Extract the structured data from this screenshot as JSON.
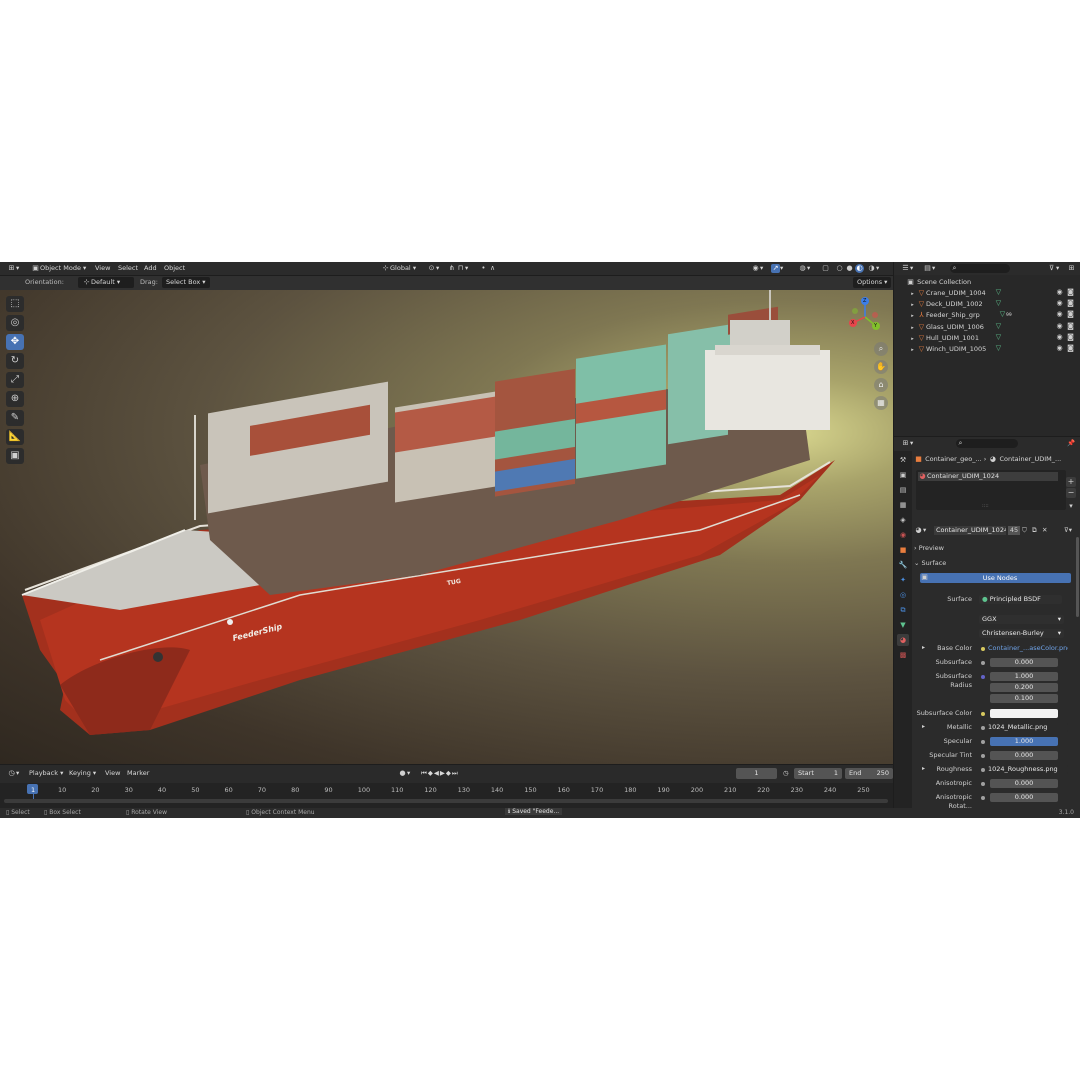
{
  "header": {
    "mode": "Object Mode",
    "menus": [
      "View",
      "Select",
      "Add",
      "Object"
    ],
    "orientation_global": "Global"
  },
  "tool_settings": {
    "orientation_label": "Orientation:",
    "orientation_value": "Default",
    "drag_label": "Drag:",
    "drag_value": "Select Box",
    "options": "Options"
  },
  "viewport": {
    "ship_name": "FeederShip",
    "hull_text": "TUG",
    "gizmo": {
      "x": "X",
      "y": "Y",
      "z": "Z"
    }
  },
  "timeline": {
    "menus": [
      "Playback",
      "Keying",
      "View",
      "Marker"
    ],
    "current_frame": "1",
    "start_label": "Start",
    "start_value": "1",
    "end_label": "End",
    "end_value": "250",
    "ticks": [
      "1",
      "10",
      "20",
      "30",
      "40",
      "50",
      "60",
      "70",
      "80",
      "90",
      "100",
      "110",
      "120",
      "130",
      "140",
      "150",
      "160",
      "170",
      "180",
      "190",
      "200",
      "210",
      "220",
      "230",
      "240",
      "250"
    ]
  },
  "status": {
    "select": "Select",
    "box_select": "Box Select",
    "rotate_view": "Rotate View",
    "context_menu": "Object Context Menu",
    "saved": "Saved \"Feede...",
    "version": "3.1.0"
  },
  "outliner": {
    "collection": "Scene Collection",
    "items": [
      {
        "label": "Crane_UDIM_1004"
      },
      {
        "label": "Deck_UDIM_1002"
      },
      {
        "label": "Feeder_Ship_grp",
        "badge": "99"
      },
      {
        "label": "Glass_UDIM_1006"
      },
      {
        "label": "Hull_UDIM_1001"
      },
      {
        "label": "Winch_UDIM_1005"
      }
    ]
  },
  "properties": {
    "breadcrumb_object": "Container_geo_...",
    "breadcrumb_material": "Container_UDIM_...",
    "slot": "Container_UDIM_1024",
    "material_name": "Container_UDIM_1024",
    "material_users": "45",
    "preview": "Preview",
    "surface_panel": "Surface",
    "use_nodes": "Use Nodes",
    "surface_label": "Surface",
    "surface_value": "Principled BSDF",
    "distribution": "GGX",
    "subsurface_method": "Christensen-Burley",
    "rows": {
      "base_color_label": "Base Color",
      "base_color_value": "Container_...aseColor.png",
      "subsurface_label": "Subsurface",
      "subsurface_value": "0.000",
      "ss_radius_label": "Subsurface Radius",
      "ss_radius_1": "1.000",
      "ss_radius_2": "0.200",
      "ss_radius_3": "0.100",
      "ss_color_label": "Subsurface Color",
      "metallic_label": "Metallic",
      "metallic_value": "1024_Metallic.png",
      "specular_label": "Specular",
      "specular_value": "1.000",
      "specular_tint_label": "Specular Tint",
      "specular_tint_value": "0.000",
      "roughness_label": "Roughness",
      "roughness_value": "1024_Roughness.png",
      "anisotropic_label": "Anisotropic",
      "anisotropic_value": "0.000",
      "aniso_rot_label": "Anisotropic Rotat...",
      "aniso_rot_value": "0.000"
    }
  },
  "colors": {
    "accent": "#4772b3",
    "hull_red": "#b5341f",
    "mesh_icon": "#e87d3e",
    "gizmo_x": "#e8454b",
    "gizmo_y": "#82c12b",
    "gizmo_z": "#3d7ee8"
  }
}
